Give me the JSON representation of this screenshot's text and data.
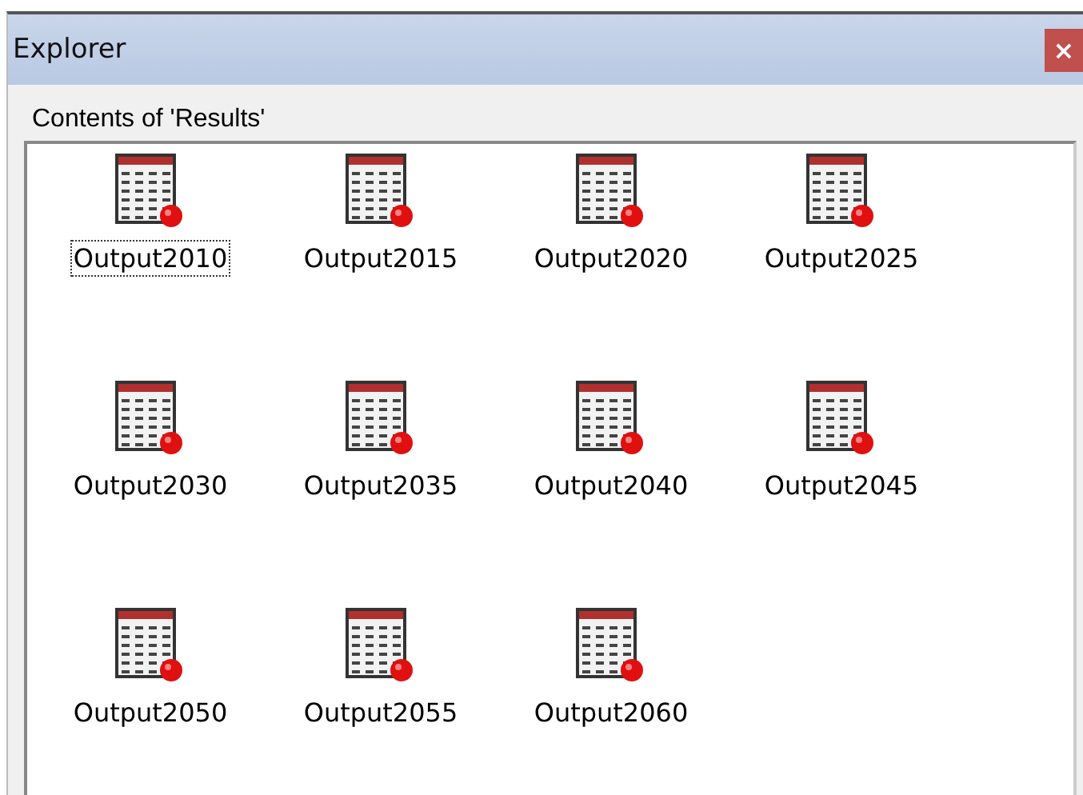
{
  "window": {
    "title": "Explorer",
    "close": "×"
  },
  "panel": {
    "heading": "Contents of 'Results'"
  },
  "items": [
    {
      "label": "Output2010",
      "selected": true
    },
    {
      "label": "Output2015",
      "selected": false
    },
    {
      "label": "Output2020",
      "selected": false
    },
    {
      "label": "Output2025",
      "selected": false
    },
    {
      "label": "Output2030",
      "selected": false
    },
    {
      "label": "Output2035",
      "selected": false
    },
    {
      "label": "Output2040",
      "selected": false
    },
    {
      "label": "Output2045",
      "selected": false
    },
    {
      "label": "Output2050",
      "selected": false
    },
    {
      "label": "Output2055",
      "selected": false
    },
    {
      "label": "Output2060",
      "selected": false
    }
  ]
}
